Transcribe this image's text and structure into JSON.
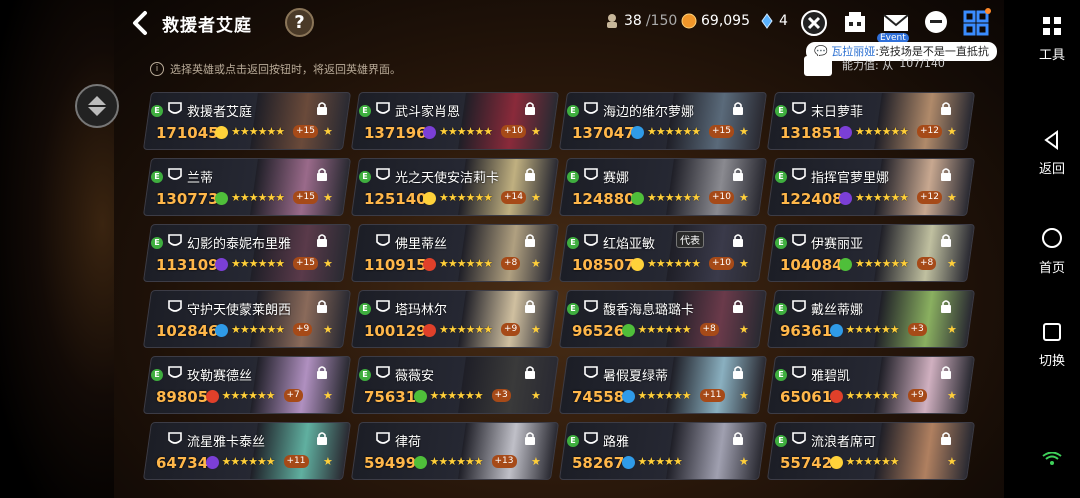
{
  "header": {
    "title": "救援者艾庭",
    "help": "?",
    "hero_count": "38",
    "hero_max": "/150",
    "gold": "69,095",
    "gem": "4",
    "event_label": "Event"
  },
  "chat": {
    "name": "瓦拉丽娅",
    "message": ":竞技场是不是一直抵抗"
  },
  "stat_right": {
    "label": "能力值: 从",
    "value": "107/140"
  },
  "hint": "选择英雄或点击返回按钮时，将返回英雄界面。",
  "colors": {
    "power": "#ffb74a",
    "dark": "#7b3fd6",
    "light": "#ffd23a",
    "fire": "#e0402a",
    "water": "#2f9be8",
    "earth": "#4fbf3a",
    "star": "#ffcf3a"
  },
  "heroes": [
    {
      "name": "救援者艾庭",
      "power": "171045",
      "element": "light",
      "stars": "★★★★★★",
      "plus": "+15",
      "e": true
    },
    {
      "name": "武斗家肖恩",
      "power": "137196",
      "element": "dark",
      "stars": "★★★★★★",
      "plus": "+10",
      "e": true
    },
    {
      "name": "海边的维尔萝娜",
      "power": "137047",
      "element": "water",
      "stars": "★★★★★★",
      "plus": "+15",
      "e": true
    },
    {
      "name": "末日萝菲",
      "power": "131851",
      "element": "dark",
      "stars": "★★★★★★",
      "plus": "+12",
      "e": true
    },
    {
      "name": "兰蒂",
      "power": "130773",
      "element": "earth",
      "stars": "★★★★★★",
      "plus": "+15",
      "e": true
    },
    {
      "name": "光之天使安洁莉卡",
      "power": "125140",
      "element": "light",
      "stars": "★★★★★★",
      "plus": "+14",
      "e": true
    },
    {
      "name": "赛娜",
      "power": "124880",
      "element": "earth",
      "stars": "★★★★★★",
      "plus": "+10",
      "e": true
    },
    {
      "name": "指挥官萝里娜",
      "power": "122408",
      "element": "dark",
      "stars": "★★★★★★",
      "plus": "+12",
      "e": true
    },
    {
      "name": "幻影的泰妮布里雅",
      "power": "113109",
      "element": "dark",
      "stars": "★★★★★★",
      "plus": "+15",
      "e": true
    },
    {
      "name": "佛里蒂丝",
      "power": "110915",
      "element": "fire",
      "stars": "★★★★★★",
      "plus": "+8",
      "e": false
    },
    {
      "name": "红焰亚敏",
      "power": "108507",
      "element": "light",
      "stars": "★★★★★★",
      "plus": "+10",
      "e": true,
      "rep": "代表"
    },
    {
      "name": "伊赛丽亚",
      "power": "104084",
      "element": "earth",
      "stars": "★★★★★★",
      "plus": "+8",
      "e": true
    },
    {
      "name": "守护天使蒙莱朗西",
      "power": "102846",
      "element": "water",
      "stars": "★★★★★★",
      "plus": "+9",
      "e": false
    },
    {
      "name": "塔玛林尔",
      "power": "100129",
      "element": "fire",
      "stars": "★★★★★★",
      "plus": "+9",
      "e": true
    },
    {
      "name": "馥香海息璐璐卡",
      "power": "96526",
      "element": "earth",
      "stars": "★★★★★★",
      "plus": "+8",
      "e": true
    },
    {
      "name": "戴丝蒂娜",
      "power": "96361",
      "element": "water",
      "stars": "★★★★★★",
      "plus": "+3",
      "e": true
    },
    {
      "name": "玫勒赛德丝",
      "power": "89805",
      "element": "fire",
      "stars": "★★★★★★",
      "plus": "+7",
      "e": true
    },
    {
      "name": "薇薇安",
      "power": "75631",
      "element": "earth",
      "stars": "★★★★★★",
      "plus": "+3",
      "e": true
    },
    {
      "name": "暑假夏绿蒂",
      "power": "74558",
      "element": "water",
      "stars": "★★★★★★",
      "plus": "+11",
      "e": false
    },
    {
      "name": "雅碧凯",
      "power": "65061",
      "element": "fire",
      "stars": "★★★★★★",
      "plus": "+9",
      "e": true
    },
    {
      "name": "流星雅卡泰丝",
      "power": "64734",
      "element": "dark",
      "stars": "★★★★★★",
      "plus": "+11",
      "e": false
    },
    {
      "name": "律荷",
      "power": "59499",
      "element": "earth",
      "stars": "★★★★★★",
      "plus": "+13",
      "e": false
    },
    {
      "name": "路雅",
      "power": "58267",
      "element": "water",
      "stars": "★★★★★",
      "plus": "",
      "e": true
    },
    {
      "name": "流浪者席可",
      "power": "55742",
      "element": "light",
      "stars": "★★★★★★",
      "plus": "",
      "e": true
    }
  ],
  "system_bar": {
    "tools": "工具",
    "back": "返回",
    "home": "首页",
    "switch": "切换"
  }
}
